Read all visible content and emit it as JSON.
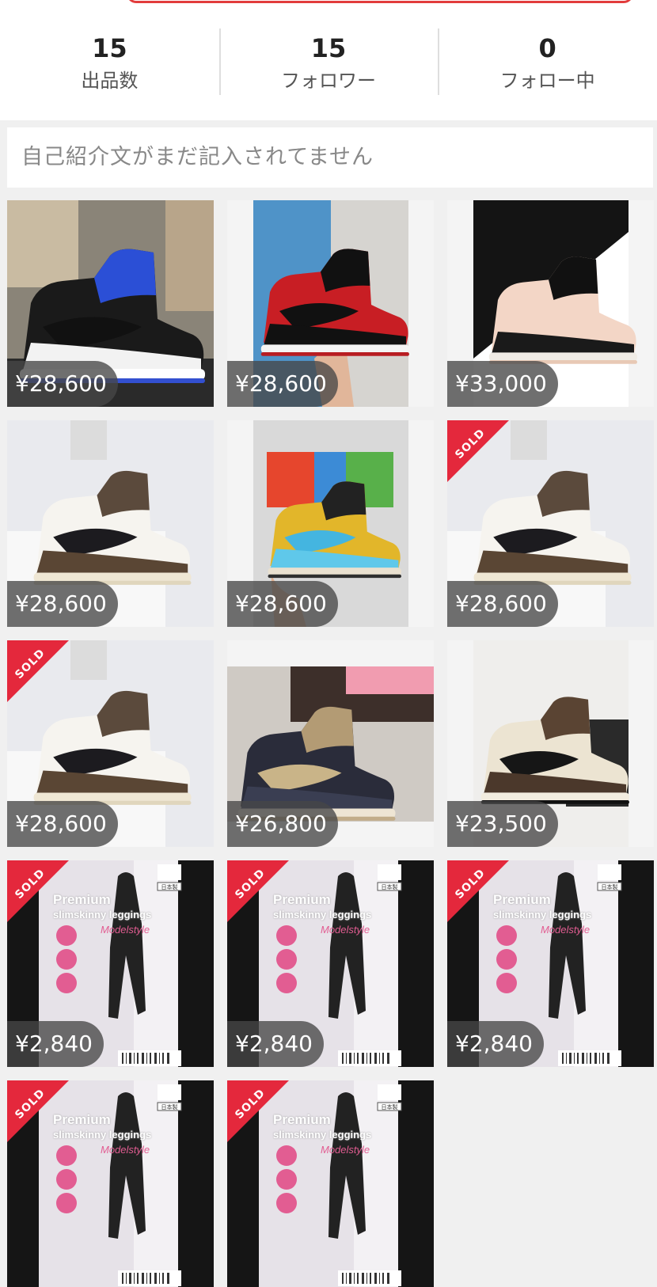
{
  "stats": [
    {
      "value": "15",
      "label": "出品数"
    },
    {
      "value": "15",
      "label": "フォロワー"
    },
    {
      "value": "0",
      "label": "フォロー中"
    }
  ],
  "bio": {
    "text": "自己紹介文がまだ記入されてません"
  },
  "sold_label": "SOLD",
  "items": [
    {
      "price": "¥28,600",
      "sold": false,
      "image": "jordan-royal-toe-shoe-photo"
    },
    {
      "price": "¥28,600",
      "sold": false,
      "image": "jordan-bred-shoe-photo"
    },
    {
      "price": "¥33,000",
      "sold": false,
      "image": "jordan-crimson-tint-shoe-photo"
    },
    {
      "price": "¥28,600",
      "sold": false,
      "image": "jordan-travis-scott-shoe-photo"
    },
    {
      "price": "¥28,600",
      "sold": false,
      "image": "sb-dunk-chunky-dunky-shoe-photo"
    },
    {
      "price": "¥28,600",
      "sold": true,
      "image": "jordan-travis-scott-shoe-photo"
    },
    {
      "price": "¥28,600",
      "sold": true,
      "image": "jordan-travis-scott-shoe-photo"
    },
    {
      "price": "¥26,800",
      "sold": false,
      "image": "sb-dunk-paisley-shoe-photo"
    },
    {
      "price": "¥23,500",
      "sold": false,
      "image": "jordan-dark-mocha-shoe-photo"
    },
    {
      "price": "¥2,840",
      "sold": true,
      "image": "leggings-package-photo"
    },
    {
      "price": "¥2,840",
      "sold": true,
      "image": "leggings-package-photo"
    },
    {
      "price": "¥2,840",
      "sold": true,
      "image": "leggings-package-photo"
    },
    {
      "price": "",
      "sold": true,
      "image": "leggings-package-photo"
    },
    {
      "price": "",
      "sold": true,
      "image": "leggings-package-photo"
    }
  ],
  "package_text": {
    "line1": "Premium",
    "line2": "slimskinny leggings",
    "script": "Modelstyle",
    "origin": "日本製"
  },
  "colors": {
    "sold_badge": "#e4283c",
    "price_overlay": "#464646"
  }
}
